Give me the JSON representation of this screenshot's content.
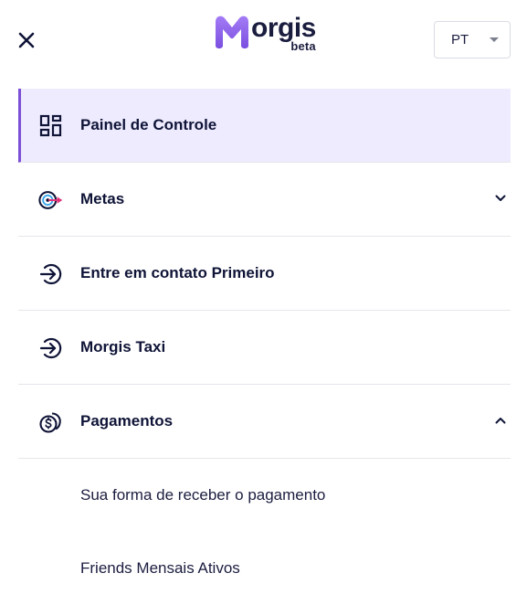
{
  "header": {
    "logo_text": "orgis",
    "logo_badge": "beta",
    "language": "PT"
  },
  "menu": {
    "items": [
      {
        "label": "Painel de Controle",
        "icon": "dashboard-icon",
        "active": true
      },
      {
        "label": "Metas",
        "icon": "target-icon",
        "expandable": true,
        "expanded": false
      },
      {
        "label": "Entre em contato Primeiro",
        "icon": "login-arrow-icon"
      },
      {
        "label": "Morgis Taxi",
        "icon": "login-arrow-icon"
      },
      {
        "label": "Pagamentos",
        "icon": "coins-icon",
        "expandable": true,
        "expanded": true
      }
    ],
    "sub_items": [
      {
        "label": "Sua forma de receber o pagamento"
      },
      {
        "label": "Friends Mensais Ativos"
      }
    ]
  },
  "colors": {
    "accent": "#7c4fd6",
    "active_bg": "#eeebfe",
    "text": "#0f1437",
    "divider": "#e6e7ec",
    "logo_purple": "#8b5cf6"
  }
}
